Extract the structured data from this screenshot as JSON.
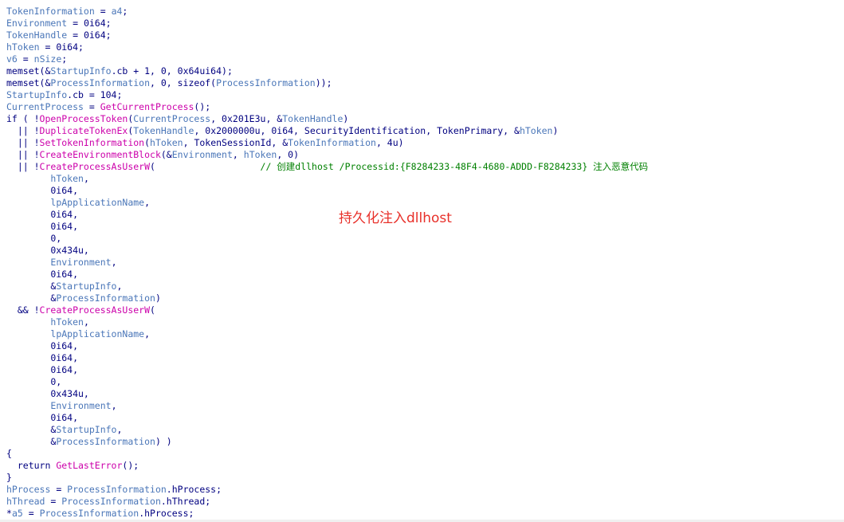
{
  "annotation": "持久化注入dllhost",
  "colors": {
    "variable": "#4a76b8",
    "function": "#cc00aa",
    "keyword": "#000080",
    "comment": "#008000",
    "annotation": "#e8302a"
  },
  "code_lines": [
    [
      {
        "t": "TokenInformation",
        "c": "v"
      },
      {
        "t": " = ",
        "c": "n"
      },
      {
        "t": "a4",
        "c": "v"
      },
      {
        "t": ";",
        "c": "n"
      }
    ],
    [
      {
        "t": "Environment",
        "c": "v"
      },
      {
        "t": " = 0i64;",
        "c": "n"
      }
    ],
    [
      {
        "t": "TokenHandle",
        "c": "v"
      },
      {
        "t": " = 0i64;",
        "c": "n"
      }
    ],
    [
      {
        "t": "hToken",
        "c": "v"
      },
      {
        "t": " = 0i64;",
        "c": "n"
      }
    ],
    [
      {
        "t": "v6",
        "c": "v"
      },
      {
        "t": " = ",
        "c": "n"
      },
      {
        "t": "nSize",
        "c": "v"
      },
      {
        "t": ";",
        "c": "n"
      }
    ],
    [
      {
        "t": "memset(&",
        "c": "k"
      },
      {
        "t": "StartupInfo",
        "c": "v"
      },
      {
        "t": ".cb + 1, 0, 0x64ui64);",
        "c": "n"
      }
    ],
    [
      {
        "t": "memset(&",
        "c": "k"
      },
      {
        "t": "ProcessInformation",
        "c": "v"
      },
      {
        "t": ", 0, sizeof(",
        "c": "n"
      },
      {
        "t": "ProcessInformation",
        "c": "v"
      },
      {
        "t": "));",
        "c": "n"
      }
    ],
    [
      {
        "t": "StartupInfo",
        "c": "v"
      },
      {
        "t": ".cb = 104;",
        "c": "n"
      }
    ],
    [
      {
        "t": "CurrentProcess",
        "c": "v"
      },
      {
        "t": " = ",
        "c": "n"
      },
      {
        "t": "GetCurrentProcess",
        "c": "f"
      },
      {
        "t": "();",
        "c": "n"
      }
    ],
    [
      {
        "t": "if ( !",
        "c": "k"
      },
      {
        "t": "OpenProcessToken",
        "c": "f"
      },
      {
        "t": "(",
        "c": "n"
      },
      {
        "t": "CurrentProcess",
        "c": "v"
      },
      {
        "t": ", 0x201E3u, &",
        "c": "n"
      },
      {
        "t": "TokenHandle",
        "c": "v"
      },
      {
        "t": ")",
        "c": "n"
      }
    ],
    [
      {
        "t": "  || !",
        "c": "k"
      },
      {
        "t": "DuplicateTokenEx",
        "c": "f"
      },
      {
        "t": "(",
        "c": "n"
      },
      {
        "t": "TokenHandle",
        "c": "v"
      },
      {
        "t": ", 0x2000000u, 0i64, SecurityIdentification, TokenPrimary, &",
        "c": "n"
      },
      {
        "t": "hToken",
        "c": "v"
      },
      {
        "t": ")",
        "c": "n"
      }
    ],
    [
      {
        "t": "  || !",
        "c": "k"
      },
      {
        "t": "SetTokenInformation",
        "c": "f"
      },
      {
        "t": "(",
        "c": "n"
      },
      {
        "t": "hToken",
        "c": "v"
      },
      {
        "t": ", TokenSessionId, &",
        "c": "n"
      },
      {
        "t": "TokenInformation",
        "c": "v"
      },
      {
        "t": ", 4u)",
        "c": "n"
      }
    ],
    [
      {
        "t": "  || !",
        "c": "k"
      },
      {
        "t": "CreateEnvironmentBlock",
        "c": "f"
      },
      {
        "t": "(&",
        "c": "n"
      },
      {
        "t": "Environment",
        "c": "v"
      },
      {
        "t": ", ",
        "c": "n"
      },
      {
        "t": "hToken",
        "c": "v"
      },
      {
        "t": ", 0)",
        "c": "n"
      }
    ],
    [
      {
        "t": "  || !",
        "c": "k"
      },
      {
        "t": "CreateProcessAsUserW",
        "c": "f"
      },
      {
        "t": "(                   ",
        "c": "n"
      },
      {
        "t": "// 创建dllhost /Processid:{F8284233-48F4-4680-ADDD-F8284233} 注入恶意代码",
        "c": "c"
      }
    ],
    [
      {
        "t": "        ",
        "c": "n"
      },
      {
        "t": "hToken",
        "c": "v"
      },
      {
        "t": ",",
        "c": "n"
      }
    ],
    [
      {
        "t": "        0i64,",
        "c": "n"
      }
    ],
    [
      {
        "t": "        ",
        "c": "n"
      },
      {
        "t": "lpApplicationName",
        "c": "v"
      },
      {
        "t": ",",
        "c": "n"
      }
    ],
    [
      {
        "t": "        0i64,",
        "c": "n"
      }
    ],
    [
      {
        "t": "        0i64,",
        "c": "n"
      }
    ],
    [
      {
        "t": "        0,",
        "c": "n"
      }
    ],
    [
      {
        "t": "        0x434u,",
        "c": "n"
      }
    ],
    [
      {
        "t": "        ",
        "c": "n"
      },
      {
        "t": "Environment",
        "c": "v"
      },
      {
        "t": ",",
        "c": "n"
      }
    ],
    [
      {
        "t": "        0i64,",
        "c": "n"
      }
    ],
    [
      {
        "t": "        &",
        "c": "n"
      },
      {
        "t": "StartupInfo",
        "c": "v"
      },
      {
        "t": ",",
        "c": "n"
      }
    ],
    [
      {
        "t": "        &",
        "c": "n"
      },
      {
        "t": "ProcessInformation",
        "c": "v"
      },
      {
        "t": ")",
        "c": "n"
      }
    ],
    [
      {
        "t": "  && !",
        "c": "k"
      },
      {
        "t": "CreateProcessAsUserW",
        "c": "f"
      },
      {
        "t": "(",
        "c": "n"
      }
    ],
    [
      {
        "t": "        ",
        "c": "n"
      },
      {
        "t": "hToken",
        "c": "v"
      },
      {
        "t": ",",
        "c": "n"
      }
    ],
    [
      {
        "t": "        ",
        "c": "n"
      },
      {
        "t": "lpApplicationName",
        "c": "v"
      },
      {
        "t": ",",
        "c": "n"
      }
    ],
    [
      {
        "t": "        0i64,",
        "c": "n"
      }
    ],
    [
      {
        "t": "        0i64,",
        "c": "n"
      }
    ],
    [
      {
        "t": "        0i64,",
        "c": "n"
      }
    ],
    [
      {
        "t": "        0,",
        "c": "n"
      }
    ],
    [
      {
        "t": "        0x434u,",
        "c": "n"
      }
    ],
    [
      {
        "t": "        ",
        "c": "n"
      },
      {
        "t": "Environment",
        "c": "v"
      },
      {
        "t": ",",
        "c": "n"
      }
    ],
    [
      {
        "t": "        0i64,",
        "c": "n"
      }
    ],
    [
      {
        "t": "        &",
        "c": "n"
      },
      {
        "t": "StartupInfo",
        "c": "v"
      },
      {
        "t": ",",
        "c": "n"
      }
    ],
    [
      {
        "t": "        &",
        "c": "n"
      },
      {
        "t": "ProcessInformation",
        "c": "v"
      },
      {
        "t": ") )",
        "c": "n"
      }
    ],
    [
      {
        "t": "{",
        "c": "k"
      }
    ],
    [
      {
        "t": "  return ",
        "c": "k"
      },
      {
        "t": "GetLastError",
        "c": "f"
      },
      {
        "t": "();",
        "c": "n"
      }
    ],
    [
      {
        "t": "}",
        "c": "k"
      }
    ],
    [
      {
        "t": "hProcess",
        "c": "v"
      },
      {
        "t": " = ",
        "c": "n"
      },
      {
        "t": "ProcessInformation",
        "c": "v"
      },
      {
        "t": ".hProcess;",
        "c": "n"
      }
    ],
    [
      {
        "t": "hThread",
        "c": "v"
      },
      {
        "t": " = ",
        "c": "n"
      },
      {
        "t": "ProcessInformation",
        "c": "v"
      },
      {
        "t": ".hThread;",
        "c": "n"
      }
    ],
    [
      {
        "t": "*",
        "c": "n"
      },
      {
        "t": "a5",
        "c": "v"
      },
      {
        "t": " = ",
        "c": "n"
      },
      {
        "t": "ProcessInformation",
        "c": "v"
      },
      {
        "t": ".hProcess;",
        "c": "n"
      }
    ]
  ]
}
